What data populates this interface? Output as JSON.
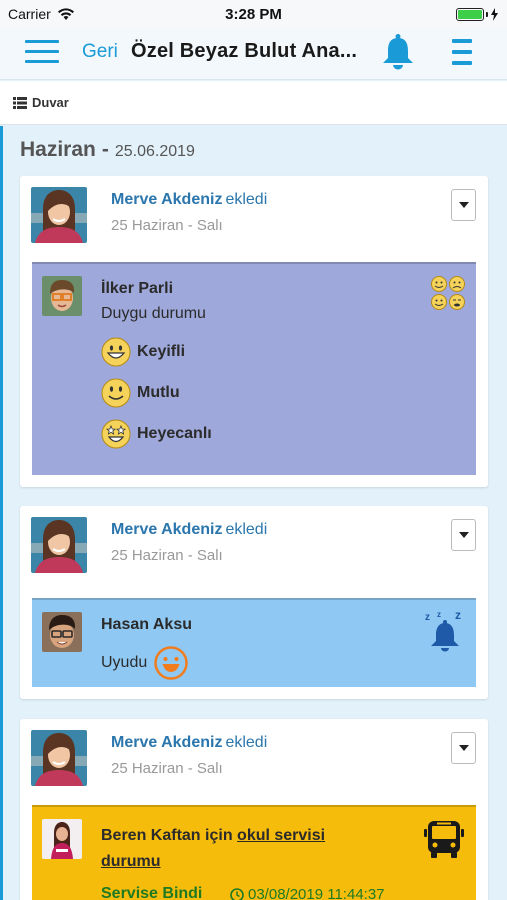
{
  "status_bar": {
    "carrier": "Carrier",
    "time": "3:28 PM"
  },
  "nav": {
    "back_label": "Geri",
    "title": "Özel Beyaz Bulut Ana..."
  },
  "tab": {
    "label": "Duvar"
  },
  "date_header": {
    "month": "Haziran",
    "separator": "-",
    "date": "25.06.2019"
  },
  "posts": [
    {
      "author": "Merve Akdeniz",
      "verb": "ekledi",
      "meta": "25 Haziran - Salı",
      "child": "İlker Parli",
      "subtitle": "Duygu durumu",
      "moods": [
        "Keyifli",
        "Mutlu",
        "Heyecanlı"
      ],
      "panel_color": "#9ea8da"
    },
    {
      "author": "Merve Akdeniz",
      "verb": "ekledi",
      "meta": "25 Haziran - Salı",
      "child": "Hasan Aksu",
      "status": "Uyudu",
      "panel_color": "#8fc9f3"
    },
    {
      "author": "Merve Akdeniz",
      "verb": "ekledi",
      "meta": "25 Haziran - Salı",
      "child_line": "Beren Kaftan için",
      "link_text_1": "okul servisi",
      "link_text_2": "durumu",
      "service_status": "Servise Bindi",
      "timestamp": "03/08/2019 11:44:37",
      "panel_color": "#f6bc0c"
    }
  ],
  "colors": {
    "accent": "#1a9bd7",
    "author_link": "#2a76ad",
    "background": "#e3f1fa"
  }
}
